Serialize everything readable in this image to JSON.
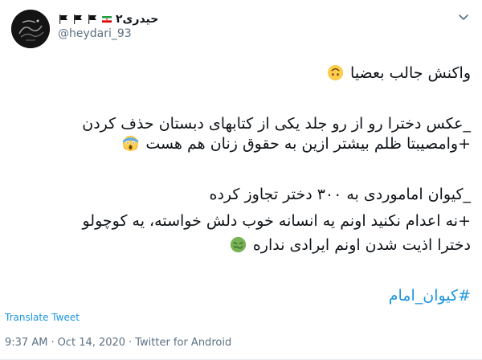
{
  "author": {
    "display_name": "حیدری۲",
    "handle": "@heydari_93",
    "flag_icon": "iran-flag-icon",
    "badge_icon": "black-flag-icon"
  },
  "tweet": {
    "line1": "واکنش جالب بعضیا",
    "line2": "_عکس دخترا رو از رو جلد یکی از کتابهای دبستان حذف کردن",
    "line3": "+وامصیبتا ظلم بیشتر ازین به حقوق زنان هم هست",
    "line4": "_کیوان اماموردی به ۳۰۰ دختر تجاوز کرده",
    "line5": "+نه اعدام نکنید اونم یه انسانه خوب دلش خواسته، یه کوچولو",
    "line6": "دخترا اذیت شدن اونم ایرادی نداره",
    "hashtag": "#کیوان_امام",
    "emojis": [
      "upside-down-face-emoji",
      "screaming-face-emoji",
      "nauseated-face-emoji"
    ]
  },
  "translate_label": "Translate Tweet",
  "meta": {
    "time": "9:37 AM",
    "separator1": "·",
    "date": "Oct 14, 2020",
    "separator2": "·",
    "source": "Twitter for Android"
  },
  "colors": {
    "link": "#1b95e0",
    "secondary_text": "#5b7083",
    "primary_text": "#0f1419"
  }
}
